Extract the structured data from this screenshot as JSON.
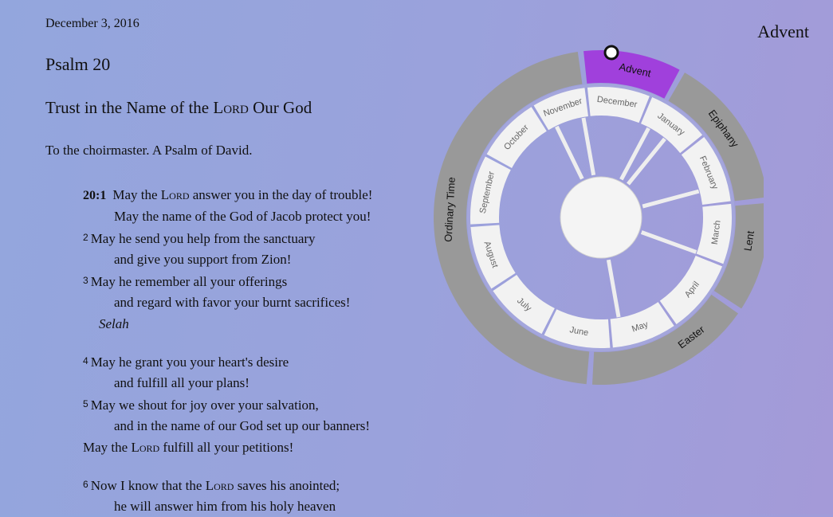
{
  "header": {
    "date": "December 3, 2016",
    "season": "Advent"
  },
  "psalm": {
    "title": "Psalm 20",
    "heading_before": "Trust in the Name of the ",
    "heading_lord": "Lord",
    "heading_after": " Our God",
    "superscript": "To the choirmaster. A Psalm of David.",
    "verse_ref": "20:1",
    "lord": "Lord",
    "selah": "Selah",
    "v1a_pre": "May the ",
    "v1a_post": " answer you in the day of trouble!",
    "v1b": "May the name of the God of Jacob protect you!",
    "v2_num": "2",
    "v2a": "May he send you help from the sanctuary",
    "v2b": "and give you support from Zion!",
    "v3_num": "3",
    "v3a": "May he remember all your offerings",
    "v3b": "and regard with favor your burnt sacrifices!",
    "v4_num": "4",
    "v4a": "May he grant you your heart's desire",
    "v4b": "and fulfill all your plans!",
    "v5_num": "5",
    "v5a": "May we shout for joy over your salvation,",
    "v5b": "and in the name of our God set up our banners!",
    "v5c_pre": "May the ",
    "v5c_post": " fulfill all your petitions!",
    "v6_num": "6",
    "v6a_pre": "Now I know that the ",
    "v6a_post": " saves his anointed;",
    "v6b": "he will answer him from his holy heaven"
  },
  "wheel": {
    "seasons": [
      "Advent",
      "Epiphany",
      "Lent",
      "Easter",
      "Ordinary Time"
    ],
    "months": [
      "December",
      "January",
      "February",
      "March",
      "April",
      "May",
      "June",
      "July",
      "August",
      "September",
      "October",
      "November"
    ],
    "colors": {
      "active_season": "#a040dc",
      "season_ring": "#999999",
      "month_ring": "#f2f2f2",
      "spokes": "#eeeeee",
      "ring_gap": "#a4a6dc"
    }
  }
}
